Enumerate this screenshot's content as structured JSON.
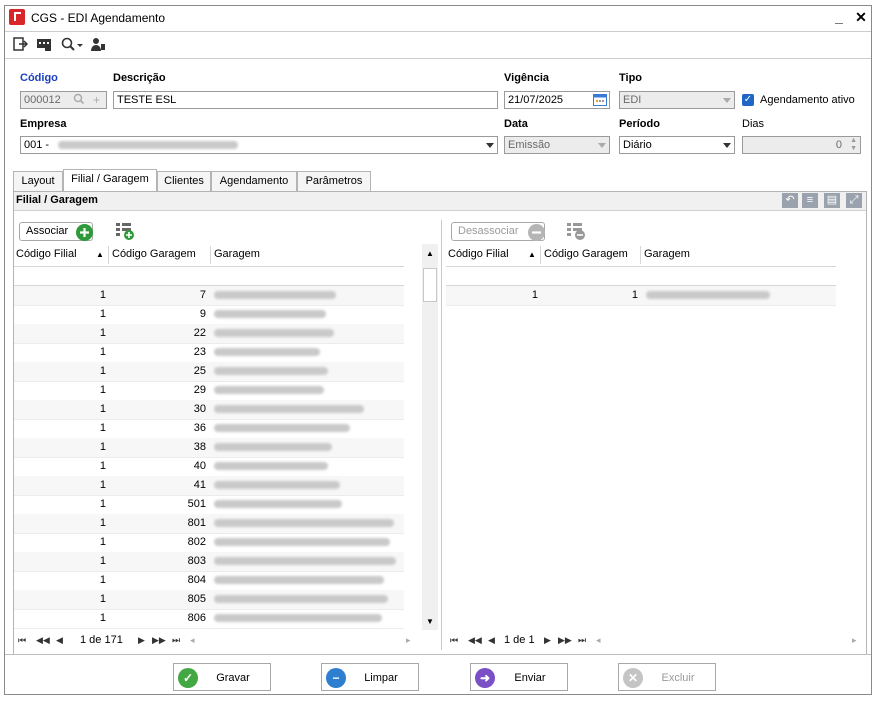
{
  "window": {
    "title": "CGS - EDI Agendamento",
    "minimize": "_",
    "close": "✕"
  },
  "toolbar": {
    "icons": [
      "exit-icon",
      "list-icon",
      "search-icon",
      "user-icon"
    ]
  },
  "form": {
    "codigo_label": "Código",
    "codigo_value": "000012",
    "descricao_label": "Descrição",
    "descricao_value": "TESTE ESL",
    "vigencia_label": "Vigência",
    "vigencia_value": "21/07/2025",
    "tipo_label": "Tipo",
    "tipo_value": "EDI",
    "agendamento_ativo_label": "Agendamento ativo",
    "empresa_label": "Empresa",
    "empresa_value": "001 -",
    "data_label": "Data",
    "data_value": "Emissão",
    "periodo_label": "Período",
    "periodo_value": "Diário",
    "dias_label": "Dias",
    "dias_value": "0"
  },
  "tabs": [
    {
      "label": "Layout"
    },
    {
      "label": "Filial / Garagem"
    },
    {
      "label": "Clientes"
    },
    {
      "label": "Agendamento"
    },
    {
      "label": "Parâmetros"
    }
  ],
  "panel": {
    "title": "Filial / Garagem"
  },
  "left_grid": {
    "button_label": "Associar",
    "headers": [
      "Código Filial",
      "Código Garagem",
      "Garagem"
    ],
    "rows": [
      {
        "filial": "1",
        "garagem": "7"
      },
      {
        "filial": "1",
        "garagem": "9"
      },
      {
        "filial": "1",
        "garagem": "22"
      },
      {
        "filial": "1",
        "garagem": "23"
      },
      {
        "filial": "1",
        "garagem": "25"
      },
      {
        "filial": "1",
        "garagem": "29"
      },
      {
        "filial": "1",
        "garagem": "30"
      },
      {
        "filial": "1",
        "garagem": "36"
      },
      {
        "filial": "1",
        "garagem": "38"
      },
      {
        "filial": "1",
        "garagem": "40"
      },
      {
        "filial": "1",
        "garagem": "41"
      },
      {
        "filial": "1",
        "garagem": "501"
      },
      {
        "filial": "1",
        "garagem": "801"
      },
      {
        "filial": "1",
        "garagem": "802"
      },
      {
        "filial": "1",
        "garagem": "803"
      },
      {
        "filial": "1",
        "garagem": "804"
      },
      {
        "filial": "1",
        "garagem": "805"
      },
      {
        "filial": "1",
        "garagem": "806"
      }
    ],
    "pager": "1 de 171"
  },
  "right_grid": {
    "button_label": "Desassociar",
    "headers": [
      "Código Filial",
      "Código Garagem",
      "Garagem"
    ],
    "rows": [
      {
        "filial": "1",
        "garagem": "1"
      }
    ],
    "pager": "1 de 1"
  },
  "footer": {
    "gravar": "Gravar",
    "limpar": "Limpar",
    "enviar": "Enviar",
    "excluir": "Excluir"
  }
}
